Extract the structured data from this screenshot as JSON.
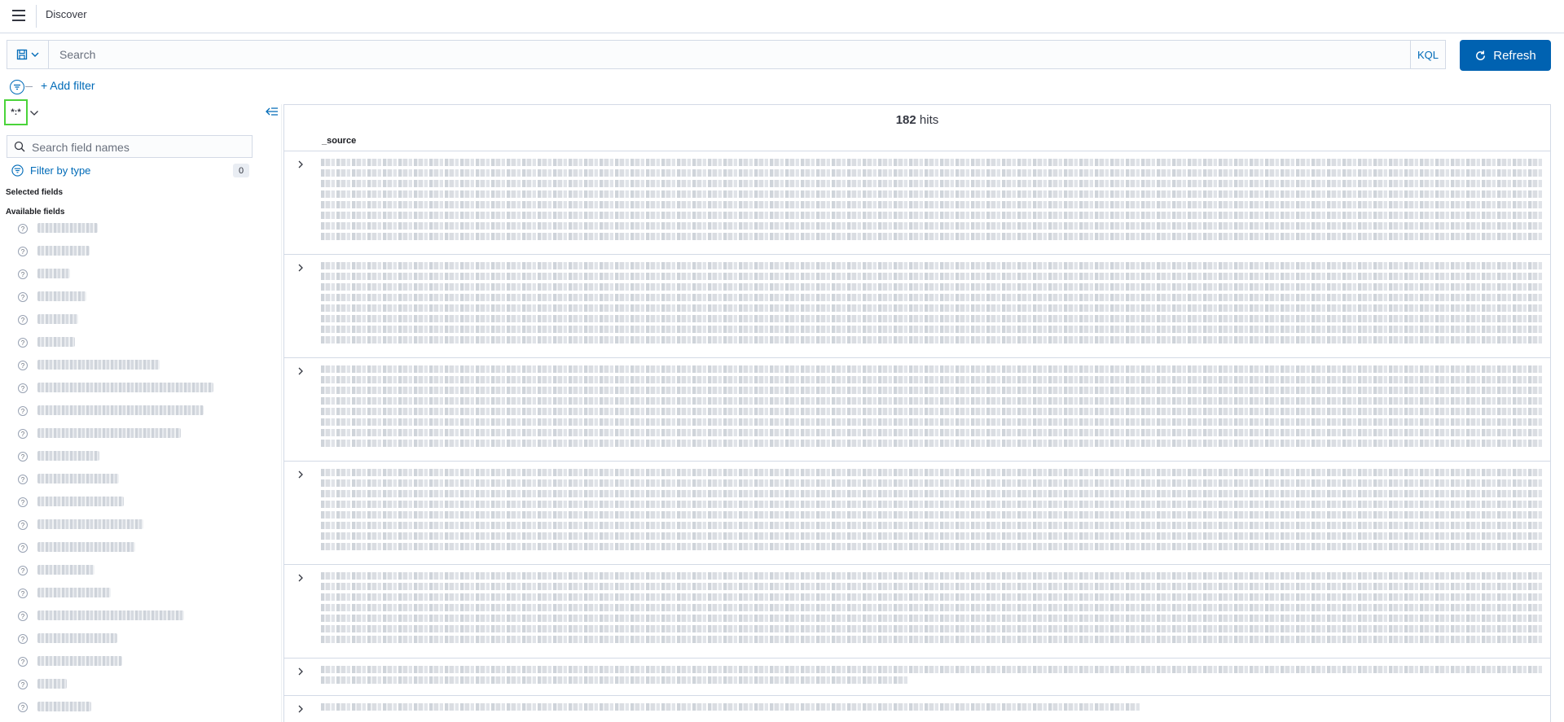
{
  "header": {
    "title": "Discover",
    "menu_icon": "hamburger-menu-icon"
  },
  "query": {
    "placeholder": "Search",
    "language": "KQL",
    "refresh_label": "Refresh",
    "saved_query_icon": "save-icon"
  },
  "filters": {
    "add_filter_label": "+ Add filter",
    "filter_icon": "filter-icon"
  },
  "sidebar": {
    "index_pattern": "*:*",
    "search_placeholder": "Search field names",
    "filter_by_type_label": "Filter by type",
    "filter_by_type_count": "0",
    "selected_fields_label": "Selected fields",
    "available_fields_label": "Available fields",
    "fields_type_icon": "question-mark-icon"
  },
  "results": {
    "hits_count": "182",
    "hits_label": "hits",
    "column_header": "_source"
  }
}
